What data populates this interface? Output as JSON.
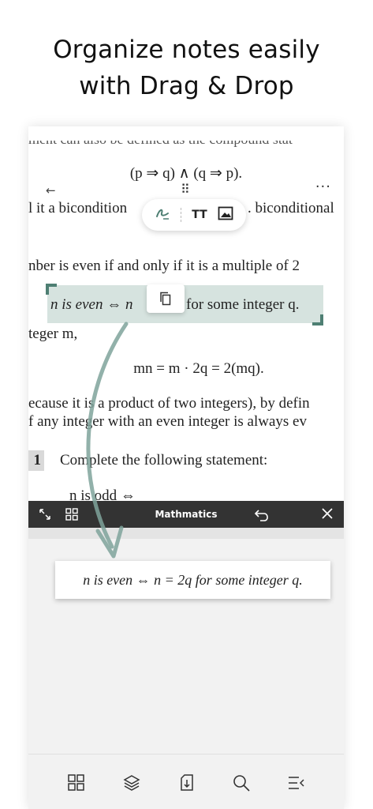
{
  "promo": {
    "line1": "Organize notes easily",
    "line2": "with Drag & Drop"
  },
  "document": {
    "cut_line": "ment can also be defined as the compound stat",
    "eq1": "(p ⇒ q) ∧ (q ⇒ p).",
    "line_bicond_left": "l it a bicondition",
    "line_bicond_right": ". biconditional",
    "line_even": "nber is even if and only if it is a multiple of 2",
    "selected_left": "n is even ⇔ n",
    "selected_right": "for some integer q.",
    "line_integer": "teger m,",
    "eq2": "mn = m · 2q = 2(mq).",
    "line_because": "ecause it is a product of two integers), by defin",
    "line_any": "f any integer with an even integer is always ev",
    "question_number": "1",
    "question_text": "Complete the following statement:",
    "odd_line": "n is odd ⇔"
  },
  "toolbar": {
    "pen_icon": "pen-icon",
    "text_icon_label": "TT",
    "image_icon": "image-icon",
    "copy_icon": "copy-icon"
  },
  "panel": {
    "title": "Mathmatics",
    "card_text": "n is even ⇔ n = 2q for some integer q."
  },
  "colors": {
    "accent": "#4e7f73",
    "selection": "#d6e3df",
    "panel_bar": "#333333",
    "arrow": "#7fa39b"
  }
}
